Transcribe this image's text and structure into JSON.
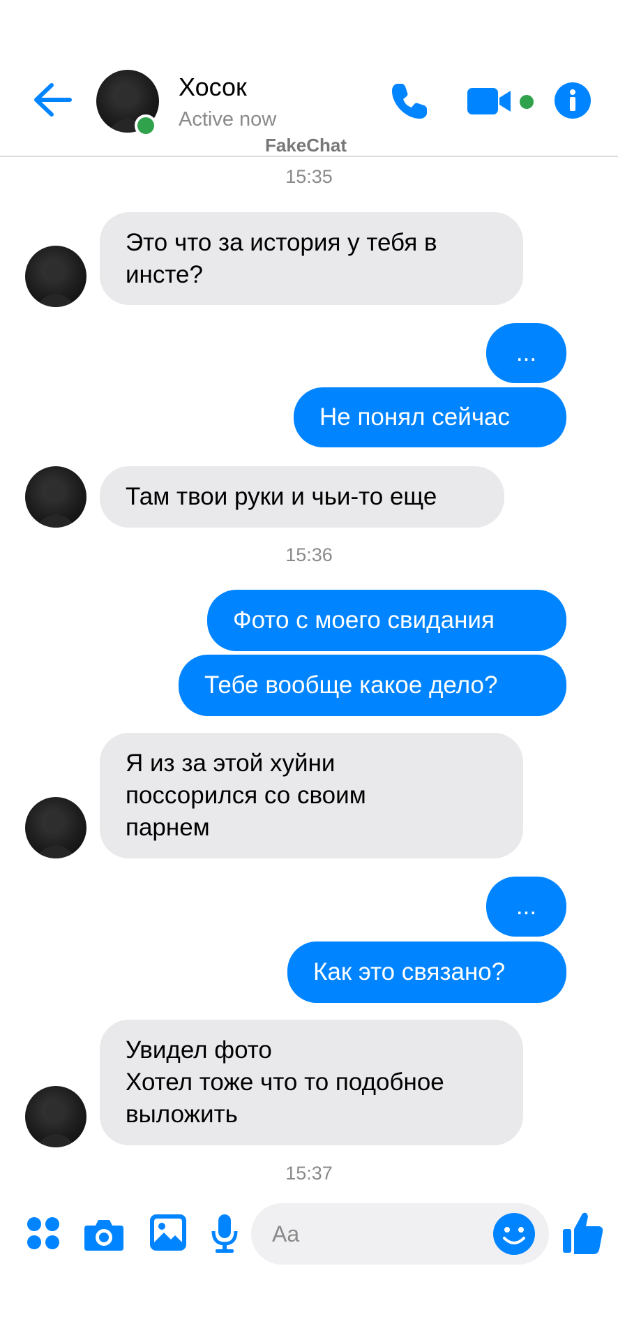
{
  "header": {
    "name": "Хосок",
    "status": "Active now",
    "watermark": "FakeChat"
  },
  "colors": {
    "accent": "#0084ff",
    "incoming_bubble": "#e9e9eb",
    "online": "#31a24c",
    "muted": "#8a8a8a"
  },
  "messages": {
    "time_1": "15:35",
    "m1": "Это что за история у тебя в инсте?",
    "m2": "...",
    "m3": "Не понял сейчас",
    "m4": "Там твои руки и чьи-то еще",
    "time_2": "15:36",
    "m5": "Фото с моего свидания",
    "m6": "Тебе вообще какое дело?",
    "m7": "Я из за этой хуйни поссорился со своим парнем",
    "m8": "...",
    "m9": "Как это связано?",
    "m10": "Увидел фото\nХотел тоже что то подобное выложить",
    "time_3": "15:37"
  },
  "composer": {
    "placeholder": "Aa"
  },
  "icons": {
    "back": "back-arrow-icon",
    "call": "phone-icon",
    "video": "video-camera-icon",
    "info": "info-icon",
    "apps": "apps-grid-icon",
    "camera": "camera-icon",
    "gallery": "gallery-icon",
    "mic": "microphone-icon",
    "emoji": "emoji-icon",
    "like": "thumbs-up-icon"
  }
}
